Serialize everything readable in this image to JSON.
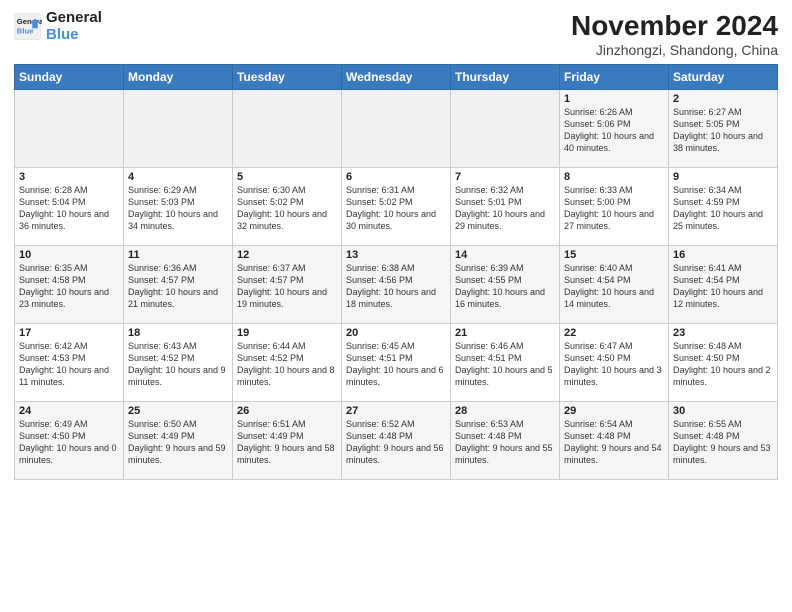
{
  "logo": {
    "line1": "General",
    "line2": "Blue"
  },
  "title": "November 2024",
  "subtitle": "Jinzhongzi, Shandong, China",
  "days_of_week": [
    "Sunday",
    "Monday",
    "Tuesday",
    "Wednesday",
    "Thursday",
    "Friday",
    "Saturday"
  ],
  "weeks": [
    [
      {
        "day": "",
        "info": ""
      },
      {
        "day": "",
        "info": ""
      },
      {
        "day": "",
        "info": ""
      },
      {
        "day": "",
        "info": ""
      },
      {
        "day": "",
        "info": ""
      },
      {
        "day": "1",
        "info": "Sunrise: 6:26 AM\nSunset: 5:06 PM\nDaylight: 10 hours and 40 minutes."
      },
      {
        "day": "2",
        "info": "Sunrise: 6:27 AM\nSunset: 5:05 PM\nDaylight: 10 hours and 38 minutes."
      }
    ],
    [
      {
        "day": "3",
        "info": "Sunrise: 6:28 AM\nSunset: 5:04 PM\nDaylight: 10 hours and 36 minutes."
      },
      {
        "day": "4",
        "info": "Sunrise: 6:29 AM\nSunset: 5:03 PM\nDaylight: 10 hours and 34 minutes."
      },
      {
        "day": "5",
        "info": "Sunrise: 6:30 AM\nSunset: 5:02 PM\nDaylight: 10 hours and 32 minutes."
      },
      {
        "day": "6",
        "info": "Sunrise: 6:31 AM\nSunset: 5:02 PM\nDaylight: 10 hours and 30 minutes."
      },
      {
        "day": "7",
        "info": "Sunrise: 6:32 AM\nSunset: 5:01 PM\nDaylight: 10 hours and 29 minutes."
      },
      {
        "day": "8",
        "info": "Sunrise: 6:33 AM\nSunset: 5:00 PM\nDaylight: 10 hours and 27 minutes."
      },
      {
        "day": "9",
        "info": "Sunrise: 6:34 AM\nSunset: 4:59 PM\nDaylight: 10 hours and 25 minutes."
      }
    ],
    [
      {
        "day": "10",
        "info": "Sunrise: 6:35 AM\nSunset: 4:58 PM\nDaylight: 10 hours and 23 minutes."
      },
      {
        "day": "11",
        "info": "Sunrise: 6:36 AM\nSunset: 4:57 PM\nDaylight: 10 hours and 21 minutes."
      },
      {
        "day": "12",
        "info": "Sunrise: 6:37 AM\nSunset: 4:57 PM\nDaylight: 10 hours and 19 minutes."
      },
      {
        "day": "13",
        "info": "Sunrise: 6:38 AM\nSunset: 4:56 PM\nDaylight: 10 hours and 18 minutes."
      },
      {
        "day": "14",
        "info": "Sunrise: 6:39 AM\nSunset: 4:55 PM\nDaylight: 10 hours and 16 minutes."
      },
      {
        "day": "15",
        "info": "Sunrise: 6:40 AM\nSunset: 4:54 PM\nDaylight: 10 hours and 14 minutes."
      },
      {
        "day": "16",
        "info": "Sunrise: 6:41 AM\nSunset: 4:54 PM\nDaylight: 10 hours and 12 minutes."
      }
    ],
    [
      {
        "day": "17",
        "info": "Sunrise: 6:42 AM\nSunset: 4:53 PM\nDaylight: 10 hours and 11 minutes."
      },
      {
        "day": "18",
        "info": "Sunrise: 6:43 AM\nSunset: 4:52 PM\nDaylight: 10 hours and 9 minutes."
      },
      {
        "day": "19",
        "info": "Sunrise: 6:44 AM\nSunset: 4:52 PM\nDaylight: 10 hours and 8 minutes."
      },
      {
        "day": "20",
        "info": "Sunrise: 6:45 AM\nSunset: 4:51 PM\nDaylight: 10 hours and 6 minutes."
      },
      {
        "day": "21",
        "info": "Sunrise: 6:46 AM\nSunset: 4:51 PM\nDaylight: 10 hours and 5 minutes."
      },
      {
        "day": "22",
        "info": "Sunrise: 6:47 AM\nSunset: 4:50 PM\nDaylight: 10 hours and 3 minutes."
      },
      {
        "day": "23",
        "info": "Sunrise: 6:48 AM\nSunset: 4:50 PM\nDaylight: 10 hours and 2 minutes."
      }
    ],
    [
      {
        "day": "24",
        "info": "Sunrise: 6:49 AM\nSunset: 4:50 PM\nDaylight: 10 hours and 0 minutes."
      },
      {
        "day": "25",
        "info": "Sunrise: 6:50 AM\nSunset: 4:49 PM\nDaylight: 9 hours and 59 minutes."
      },
      {
        "day": "26",
        "info": "Sunrise: 6:51 AM\nSunset: 4:49 PM\nDaylight: 9 hours and 58 minutes."
      },
      {
        "day": "27",
        "info": "Sunrise: 6:52 AM\nSunset: 4:48 PM\nDaylight: 9 hours and 56 minutes."
      },
      {
        "day": "28",
        "info": "Sunrise: 6:53 AM\nSunset: 4:48 PM\nDaylight: 9 hours and 55 minutes."
      },
      {
        "day": "29",
        "info": "Sunrise: 6:54 AM\nSunset: 4:48 PM\nDaylight: 9 hours and 54 minutes."
      },
      {
        "day": "30",
        "info": "Sunrise: 6:55 AM\nSunset: 4:48 PM\nDaylight: 9 hours and 53 minutes."
      }
    ]
  ]
}
